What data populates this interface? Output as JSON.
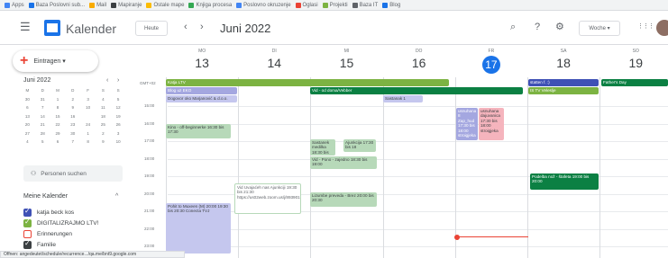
{
  "bookmarks": [
    {
      "label": "Apps",
      "color": "#4285f4"
    },
    {
      "label": "Baza Poslovni sub...",
      "color": "#1a73e8"
    },
    {
      "label": "Mail",
      "color": "#f9ab00"
    },
    {
      "label": "Mapiranje",
      "color": "#3c4043"
    },
    {
      "label": "Ostale mape",
      "color": "#fbbc04"
    },
    {
      "label": "Knjiga procesa",
      "color": "#34a853"
    },
    {
      "label": "Poslovno okruzenje",
      "color": "#4285f4"
    },
    {
      "label": "Oglasi",
      "color": "#ea4335"
    },
    {
      "label": "Projekti",
      "color": "#7cb342"
    },
    {
      "label": "Baza IT",
      "color": "#5f6368"
    },
    {
      "label": "Blog",
      "color": "#1a73e8"
    }
  ],
  "header": {
    "app_name": "Kalender",
    "today_label": "Heute",
    "prev_icon": "‹",
    "next_icon": "›",
    "month": "Juni 2022",
    "search_icon": "⌕",
    "help_icon": "?",
    "settings_icon": "⚙",
    "view_label": "Woche ▾",
    "apps_icon": "⋮⋮⋮"
  },
  "sidebar": {
    "create_label": "Eintragen ▾",
    "mini_month": "Juni 2022",
    "mini_days": [
      "M",
      "D",
      "M",
      "D",
      "F",
      "S",
      "S"
    ],
    "mini_weeks": [
      [
        "30",
        "31",
        "1",
        "2",
        "3",
        "4",
        "5"
      ],
      [
        "6",
        "7",
        "8",
        "9",
        "10",
        "11",
        "12"
      ],
      [
        "13",
        "14",
        "15",
        "16",
        "17",
        "18",
        "19"
      ],
      [
        "20",
        "21",
        "22",
        "23",
        "24",
        "25",
        "26"
      ],
      [
        "27",
        "28",
        "29",
        "30",
        "1",
        "2",
        "3"
      ],
      [
        "4",
        "5",
        "6",
        "7",
        "8",
        "9",
        "10"
      ]
    ],
    "mini_today": "17",
    "people_label": "Personen suchen",
    "my_calendars_title": "Meine Kalender",
    "calendars": [
      {
        "label": "katja beck kos",
        "color": "#3f51b5"
      },
      {
        "label": "DIGITALIZRAJMO LTV!",
        "color": "#7cb342"
      },
      {
        "label": "Erinnerungen",
        "color": "#ea4335",
        "empty": true
      },
      {
        "label": "Familie",
        "color": "#3c4043"
      }
    ]
  },
  "week": {
    "days": [
      {
        "dow": "MO",
        "num": "13"
      },
      {
        "dow": "DI",
        "num": "14"
      },
      {
        "dow": "MI",
        "num": "15"
      },
      {
        "dow": "DO",
        "num": "16"
      },
      {
        "dow": "FR",
        "num": "17",
        "today": true
      },
      {
        "dow": "SA",
        "num": "18"
      },
      {
        "dow": "SO",
        "num": "19"
      }
    ],
    "timezone": "GMT+02",
    "hours": [
      "15:00",
      "16:00",
      "17:00",
      "18:00",
      "19:00",
      "20:00",
      "21:00",
      "22:00",
      "23:00"
    ]
  },
  "events": {
    "allday_green_mon": "Katja LTV",
    "allday_lav_mon": "Blog uz EKO",
    "allday_lav_mon2": "Dogovor oko Marjanović & d.o.o.",
    "vid_mi": "Vid - od doma/Vebber",
    "llav_do": "Sastanak 1",
    "statten_sa": "statten f. :)",
    "tv_sa": "IS TV Veleslje",
    "fathers_so": "Father's Day",
    "mon_green": "Kino - off-beginnerke 16:30 bis 17:30",
    "fri_lav": "usnuhana 8 Zap_hud 17:30 bis 18:00 stroigjeka",
    "fri_pink": "usnuhana dajuvanica 17:30 bis 18:00 stroigjeka",
    "mi_green1": "Sastanek medilka 18:30 bis",
    "mi_green2": "Ajunkcija 17:30 bis 18",
    "mi_green3": "Vid - Pono - zajedno 18:30 bis 19:00",
    "sa_podelba": "Podelba nož - štafeta 19:00 bis 20:00",
    "di_outline": "Vid Uvajaćeh nas Ajunkciji 19:30 bis 21:30 https://us02web.zoom.us/j/89390120652",
    "mi_green4": "Lizumbe preveda - Brez 20:00 bis 20:30",
    "mon_lav": "Pohit to Muxeen (M) 20:00 19:30 bis 20:30 Conecta TVJ",
    "status_url": "Öffnen: angedeutet/schedule/recurrence.../qa.me/bnt9.google.com"
  }
}
